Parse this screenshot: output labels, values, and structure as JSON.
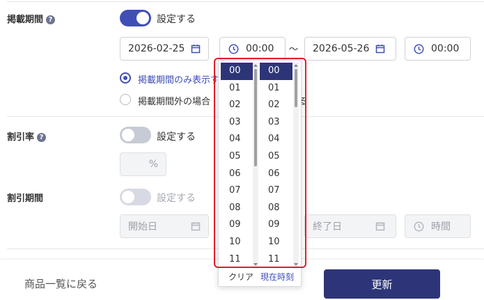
{
  "publish_period": {
    "label": "掲載期間",
    "toggle_label": "設定する",
    "start_date": "2026-02-25",
    "start_time": "00:00",
    "separator": "～",
    "end_date": "2026-05-26",
    "end_time": "00:00",
    "radio_1_label": "掲載期間のみ表示す",
    "radio_2_label": "掲載期間外の場合",
    "radio_2_suffix": "る"
  },
  "discount_rate": {
    "label": "割引率",
    "toggle_label": "設定する",
    "unit": "%"
  },
  "discount_period": {
    "label": "割引期間",
    "toggle_label": "設定する",
    "start_placeholder": "開始日",
    "end_placeholder": "終了日",
    "time_placeholder": "時間"
  },
  "time_picker": {
    "hours": [
      "00",
      "01",
      "02",
      "03",
      "04",
      "05",
      "06",
      "07",
      "08",
      "09",
      "10",
      "11"
    ],
    "minutes": [
      "00",
      "01",
      "02",
      "03",
      "04",
      "05",
      "06",
      "07",
      "08",
      "09",
      "10",
      "11"
    ],
    "selected_hour": "00",
    "selected_minute": "00",
    "clear_label": "クリア",
    "now_label": "現在時刻"
  },
  "footer": {
    "back_label": "商品一覧に戻る",
    "submit_label": "更新"
  },
  "help_icon_glyph": "?",
  "colors": {
    "accent": "#3f4fb7",
    "selected": "#2d3578",
    "highlight": "#e11d2a"
  }
}
